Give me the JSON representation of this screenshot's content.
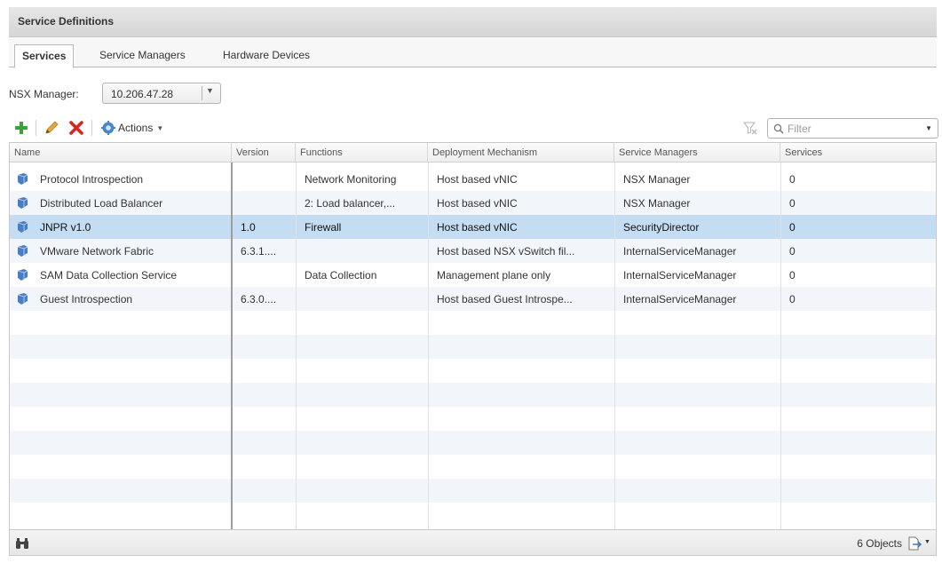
{
  "panel": {
    "title": "Service Definitions"
  },
  "tabs": [
    {
      "label": "Services",
      "active": true
    },
    {
      "label": "Service Managers",
      "active": false
    },
    {
      "label": "Hardware Devices",
      "active": false
    }
  ],
  "nsx_manager": {
    "label": "NSX Manager:",
    "value": "10.206.47.28"
  },
  "toolbar": {
    "add_icon": "plus-icon",
    "edit_icon": "pencil-icon",
    "delete_icon": "x-icon",
    "actions_label": "Actions",
    "filter_placeholder": "Filter"
  },
  "table": {
    "columns": [
      "Name",
      "Version",
      "Functions",
      "Deployment Mechanism",
      "Service Managers",
      "Services"
    ],
    "rows": [
      {
        "name": "Protocol Introspection",
        "version": "",
        "functions": "Network Monitoring",
        "deployment": "Host based vNIC",
        "managers": "NSX Manager",
        "services": "0",
        "selected": false
      },
      {
        "name": "Distributed Load Balancer",
        "version": "",
        "functions": "2: Load balancer,...",
        "deployment": "Host based vNIC",
        "managers": "NSX Manager",
        "services": "0",
        "selected": false
      },
      {
        "name": "JNPR v1.0",
        "version": "1.0",
        "functions": "Firewall",
        "deployment": "Host based vNIC",
        "managers": "SecurityDirector",
        "services": "0",
        "selected": true
      },
      {
        "name": "VMware Network Fabric",
        "version": "6.3.1....",
        "functions": "",
        "deployment": "Host based NSX vSwitch fil...",
        "managers": "InternalServiceManager",
        "services": "0",
        "selected": false
      },
      {
        "name": "SAM Data Collection Service",
        "version": "",
        "functions": "Data Collection",
        "deployment": "Management plane only",
        "managers": "InternalServiceManager",
        "services": "0",
        "selected": false
      },
      {
        "name": "Guest Introspection",
        "version": "6.3.0....",
        "functions": "",
        "deployment": "Host based Guest Introspe...",
        "managers": "InternalServiceManager",
        "services": "0",
        "selected": false
      }
    ]
  },
  "status": {
    "count": "6 Objects"
  },
  "colors": {
    "selected_row": "#c5ddf3",
    "alt_row": "#f2f6fa",
    "add_green": "#3aa23a",
    "delete_red": "#d9261c"
  }
}
